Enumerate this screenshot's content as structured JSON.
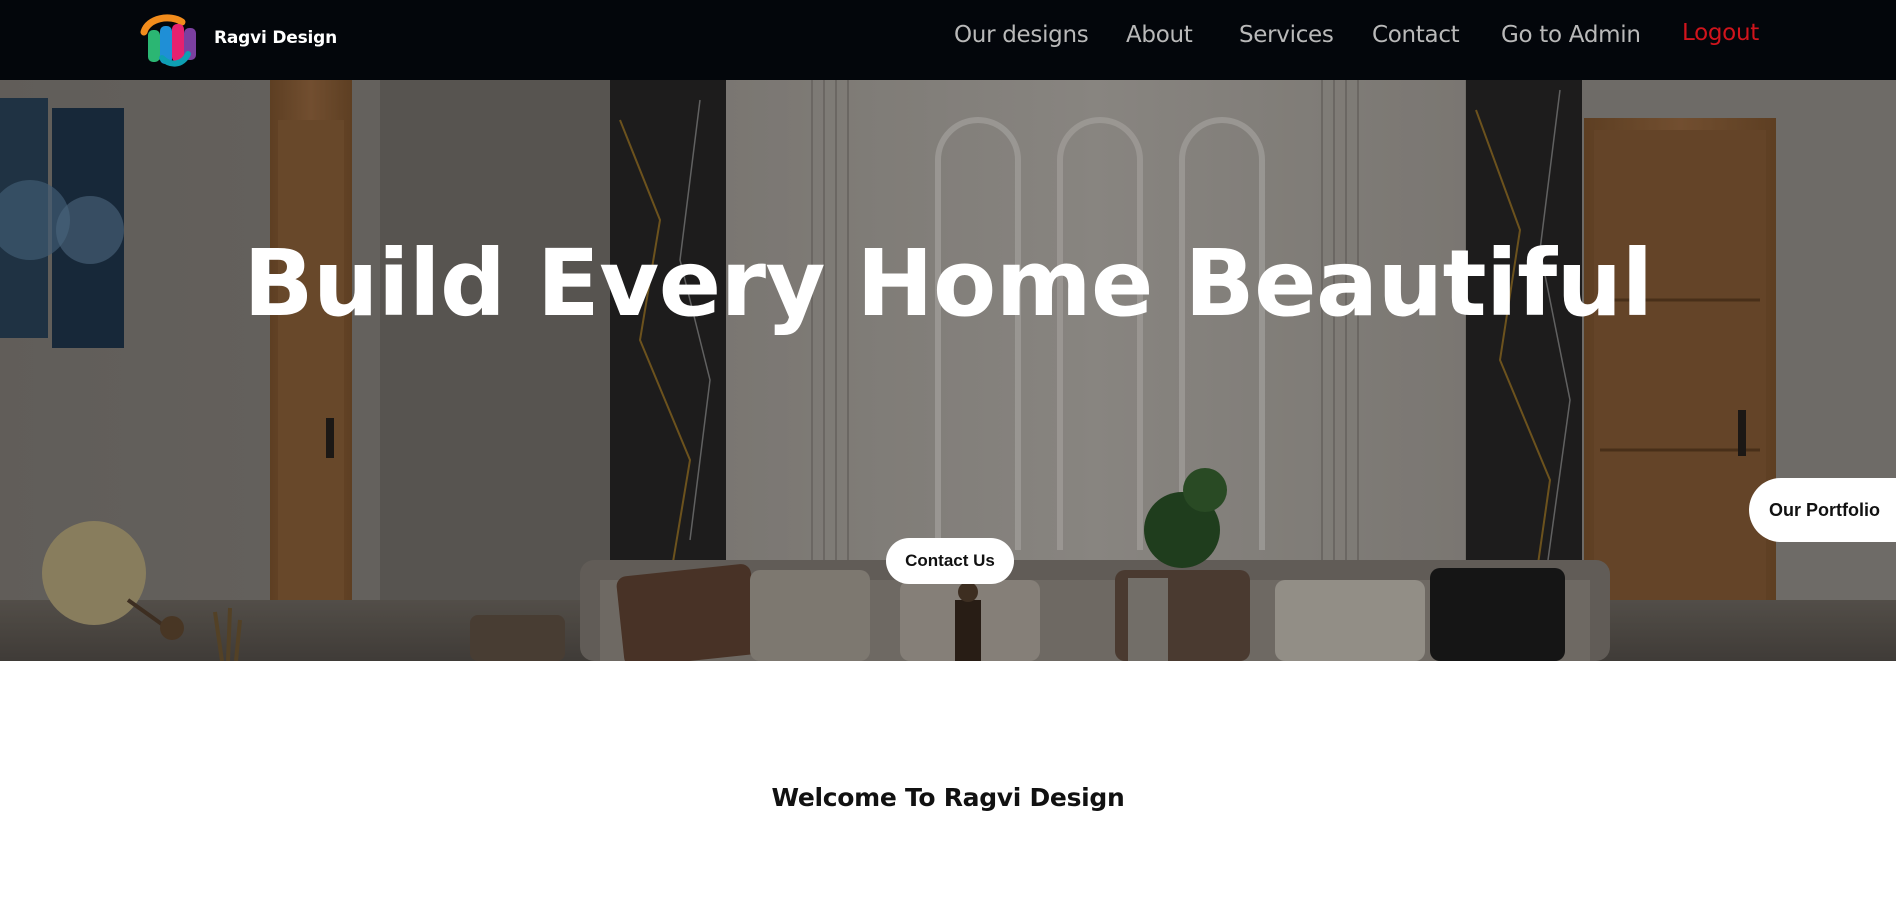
{
  "brand": {
    "name": "Ragvi Design",
    "logo_icon": "ragvi-logo",
    "logo_colors": [
      "#f28c1c",
      "#2bb673",
      "#1f8fd6",
      "#e6216f",
      "#7b3fa0"
    ]
  },
  "nav": {
    "items": [
      {
        "label": "Our designs"
      },
      {
        "label": "About"
      },
      {
        "label": "Services"
      },
      {
        "label": "Contact"
      },
      {
        "label": "Go to Admin"
      },
      {
        "label": "Logout"
      }
    ],
    "logout_color": "#d0141c"
  },
  "hero": {
    "title": "Build Every Home Beautiful",
    "cta_label": "Contact Us",
    "background": "living-room-interior-photo"
  },
  "portfolio_tab": {
    "label": "Our Portfolio"
  },
  "welcome": {
    "heading": "Welcome To Ragvi Design"
  }
}
